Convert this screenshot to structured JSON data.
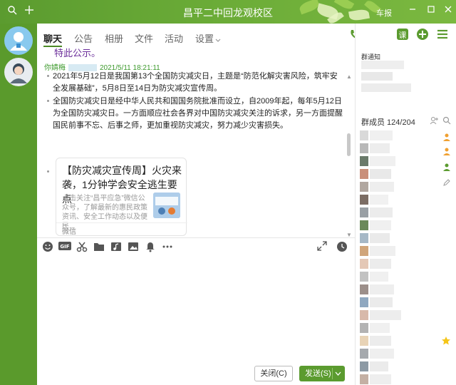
{
  "window": {
    "title": "昌平二中回龙观校区",
    "announcement_label": "车报",
    "accent": "#5b9b2f"
  },
  "tabs": [
    {
      "label": "聊天"
    },
    {
      "label": "公告"
    },
    {
      "label": "相册"
    },
    {
      "label": "文件"
    },
    {
      "label": "活动"
    },
    {
      "label": "设置"
    }
  ],
  "message": {
    "partial_header": "特此公示。",
    "sender": "你婧梅",
    "timestamp": "2021/5/11 18:21:11",
    "paragraph1": "2021年5月12日是我国第13个全国防灾减灾日，主题是“防范化解灾害风险，筑牢安全发展基础”，5月8日至14日为防灾减灾宣传周。",
    "paragraph2": "全国防灾减灾日是经中华人民共和国国务院批准而设立，自2009年起，每年5月12日为全国防灾减灾日。一方面顺应社会各界对中国防灾减灾关注的诉求，另一方面提醒国民前事不忘、后事之师，更加重视防灾减灾，努力减少灾害损失。"
  },
  "card": {
    "title": "【防灾减灾宣传周】火灾来袭，1分钟学会安全逃生要点",
    "description": "点击关注“昌平应急”微信公众号，了解最新的惠民政策资讯、安全工作动态以及便民...",
    "source": "微信"
  },
  "toolbar_icons": [
    "emoji-icon",
    "gif-icon",
    "scissors-icon",
    "folder-icon",
    "music-icon",
    "image-icon",
    "bell-icon",
    "more-icon"
  ],
  "actions": {
    "close_label": "关闭(C)",
    "send_label": "发送(S)"
  },
  "sidebar": {
    "notice_label": "群通知",
    "members_label": "群成员 124/204"
  }
}
